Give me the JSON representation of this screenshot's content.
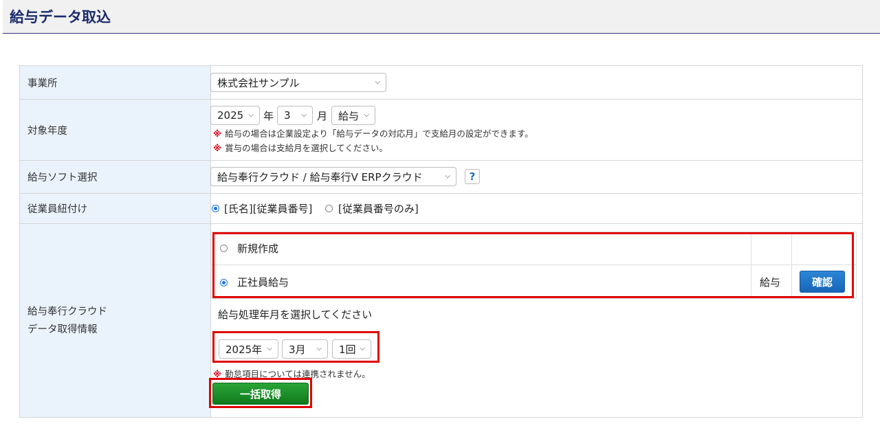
{
  "page": {
    "title": "給与データ取込"
  },
  "office": {
    "label": "事業所",
    "selected": "株式会社サンプル"
  },
  "target": {
    "label": "対象年度",
    "year": "2025",
    "year_unit": "年",
    "month": "3",
    "month_unit": "月",
    "pay_type": "給与",
    "note1": "給与の場合は企業設定より「給与データの対応月」で支給月の設定ができます。",
    "note2": "賞与の場合は支給月を選択してください。",
    "note_mark": "※"
  },
  "software": {
    "label": "給与ソフト選択",
    "selected": "給与奉行クラウド / 給与奉行V ERPクラウド",
    "help_text": "?"
  },
  "link": {
    "label": "従業員紐付け",
    "option1": "[氏名][従業員番号]",
    "option2": "[従業員番号のみ]",
    "selected_index": 0
  },
  "cloud": {
    "label_line1": "給与奉行クラウド",
    "label_line2": "データ取得情報",
    "rows": [
      {
        "name": "新規作成",
        "type": "",
        "selected": false
      },
      {
        "name": "正社員給与",
        "type": "給与",
        "selected": true,
        "button": "確認"
      }
    ],
    "prompt": "給与処理年月を選択してください",
    "year": "2025年",
    "month": "3月",
    "times": "1回",
    "warning": "勤怠項目については連携されません。",
    "fetch_button": "一括取得"
  },
  "colors": {
    "accent_blue": "#1565b8",
    "accent_green": "#107a1d",
    "highlight_red": "#e00000",
    "label_bg": "#eaf3fb"
  }
}
